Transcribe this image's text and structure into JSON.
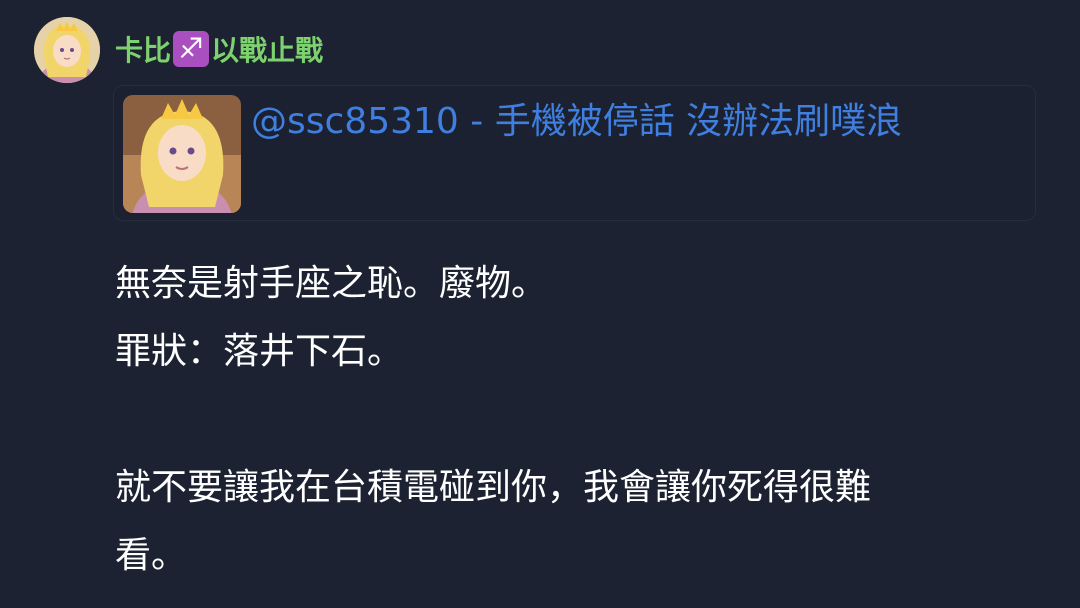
{
  "post": {
    "author": {
      "name_part1": "卡比",
      "zodiac_icon": "sagittarius-icon",
      "zodiac_glyph": "♐",
      "name_part2": "以戰止戰",
      "name_color": "#7ed16f"
    },
    "quote": {
      "title": "@ssc85310 - 手機被停話 沒辦法刷噗浪",
      "link_color": "#3f7fe0"
    },
    "content_lines": [
      "無奈是射手座之恥。廢物。",
      "罪狀：落井下石。",
      "",
      "就不要讓我在台積電碰到你，我會讓你死得很難",
      "看。"
    ]
  },
  "colors": {
    "background": "#1c2231",
    "text": "#ffffff",
    "zodiac_bg": "#a94fbf"
  }
}
